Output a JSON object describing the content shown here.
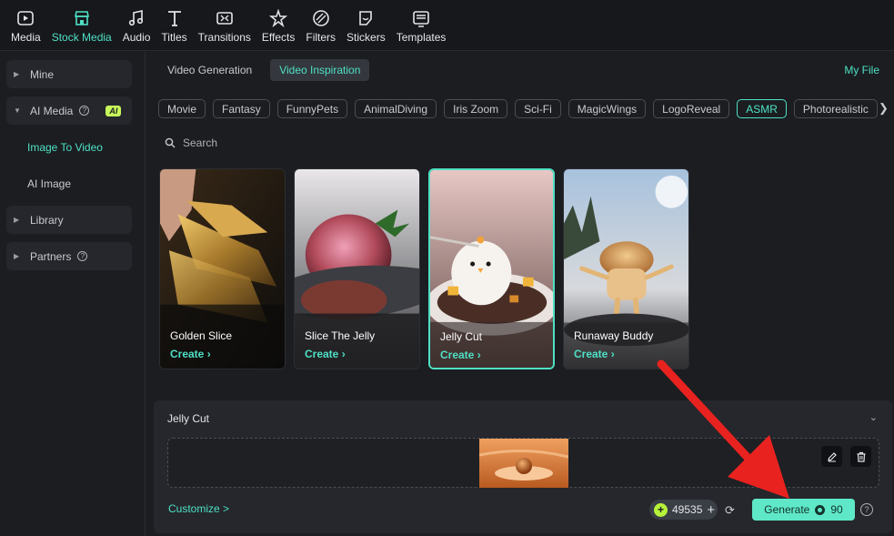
{
  "toolbar": {
    "items": [
      {
        "label": "Media",
        "icon": "media-icon"
      },
      {
        "label": "Stock Media",
        "icon": "store-icon",
        "active": true
      },
      {
        "label": "Audio",
        "icon": "music-icon"
      },
      {
        "label": "Titles",
        "icon": "text-icon"
      },
      {
        "label": "Transitions",
        "icon": "transition-icon"
      },
      {
        "label": "Effects",
        "icon": "effects-icon"
      },
      {
        "label": "Filters",
        "icon": "filter-icon"
      },
      {
        "label": "Stickers",
        "icon": "sticker-icon"
      },
      {
        "label": "Templates",
        "icon": "template-icon"
      }
    ]
  },
  "sidebar": {
    "mine": "Mine",
    "ai_media": "AI Media",
    "ai_badge": "AI",
    "image_to_video": "Image To Video",
    "ai_image": "AI Image",
    "library": "Library",
    "partners": "Partners"
  },
  "main": {
    "tabs": [
      {
        "label": "Video Generation"
      },
      {
        "label": "Video Inspiration",
        "active": true
      }
    ],
    "my_file": "My File",
    "chips": [
      "Movie",
      "Fantasy",
      "FunnyPets",
      "AnimalDiving",
      "Iris Zoom",
      "Sci-Fi",
      "MagicWings",
      "LogoReveal",
      "ASMR",
      "Photorealistic"
    ],
    "active_chip": "ASMR",
    "search_placeholder": "Search",
    "cards": [
      {
        "title": "Golden Slice",
        "cta": "Create  ›"
      },
      {
        "title": "Slice The Jelly",
        "cta": "Create  ›"
      },
      {
        "title": "Jelly Cut",
        "cta": "Create  ›",
        "selected": true
      },
      {
        "title": "Runaway Buddy",
        "cta": "Create  ›"
      }
    ]
  },
  "panel": {
    "title": "Jelly Cut",
    "customize": "Customize >",
    "credits": "49535",
    "generate_label": "Generate",
    "generate_cost": "90"
  },
  "colors": {
    "accent": "#4ee0c4",
    "generate_bg": "#5ee8c8",
    "arrow": "#e8221f",
    "ai_badge": "#c8f75a"
  }
}
